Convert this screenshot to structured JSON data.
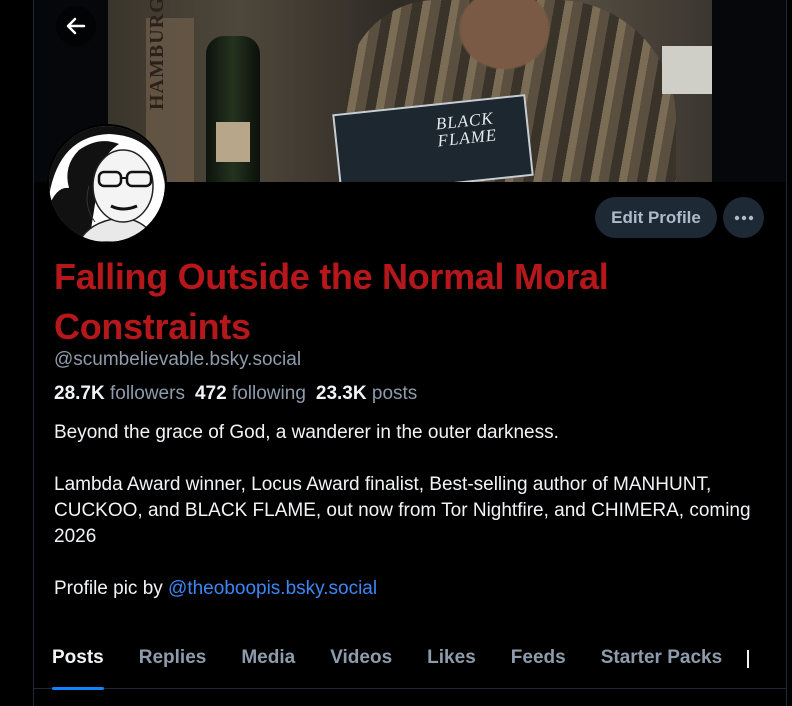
{
  "profile": {
    "display_name": "Falling Outside the Normal Moral Constraints",
    "handle": "@scumbelievable.bsky.social",
    "stats": {
      "followers_count": "28.7K",
      "followers_label": "followers",
      "following_count": "472",
      "following_label": "following",
      "posts_count": "23.3K",
      "posts_label": "posts"
    },
    "bio": {
      "line1": "Beyond the grace of God, a wanderer in the outer darkness.",
      "line2": "Lambda Award winner, Locus Award finalist, Best-selling author of MANHUNT, CUCKOO, and BLACK FLAME, out now from Tor Nightfire, and CHIMERA, coming 2026",
      "line3_prefix": "Profile pic by ",
      "line3_link": "@theoboopis.bsky.social"
    }
  },
  "banner": {
    "sign_text": "HAMBURGER",
    "book_title": "BLACK FLAME"
  },
  "actions": {
    "edit_profile": "Edit Profile"
  },
  "tabs": [
    {
      "label": "Posts"
    },
    {
      "label": "Replies"
    },
    {
      "label": "Media"
    },
    {
      "label": "Videos"
    },
    {
      "label": "Likes"
    },
    {
      "label": "Feeds"
    },
    {
      "label": "Starter Packs"
    }
  ],
  "colors": {
    "accent": "#1083fe",
    "display_name": "#b5171b",
    "link": "#3d86f5",
    "muted": "#8e9bab",
    "button_bg": "#1e2936"
  },
  "icons": {
    "back": "arrow-left-icon",
    "more": "ellipsis-icon"
  }
}
